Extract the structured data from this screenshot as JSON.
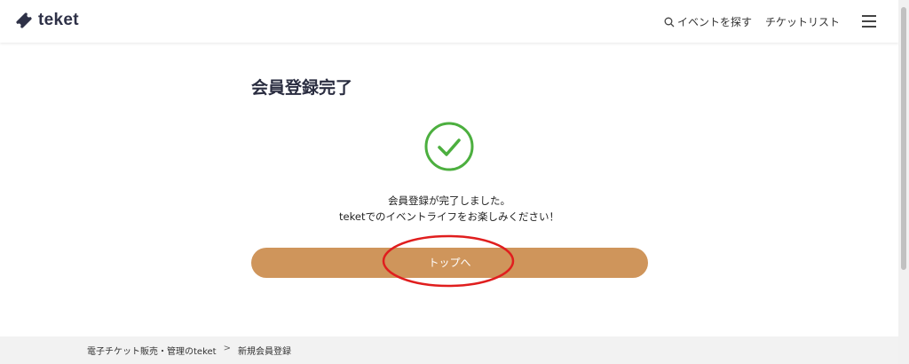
{
  "header": {
    "logo_text": "teket",
    "nav_search": "イベントを探す",
    "nav_tickets": "チケットリスト"
  },
  "main": {
    "title": "会員登録完了",
    "message_line1": "会員登録が完了しました。",
    "message_line2": "teketでのイベントライフをお楽しみください！",
    "top_button_label": "トップへ"
  },
  "breadcrumb": {
    "home": "電子チケット販売・管理のteket",
    "separator": ">",
    "current": "新規会員登録"
  },
  "colors": {
    "brand": "#2e3147",
    "button": "#cf955b",
    "success": "#4caf3f",
    "annotation": "#e01e1e"
  }
}
